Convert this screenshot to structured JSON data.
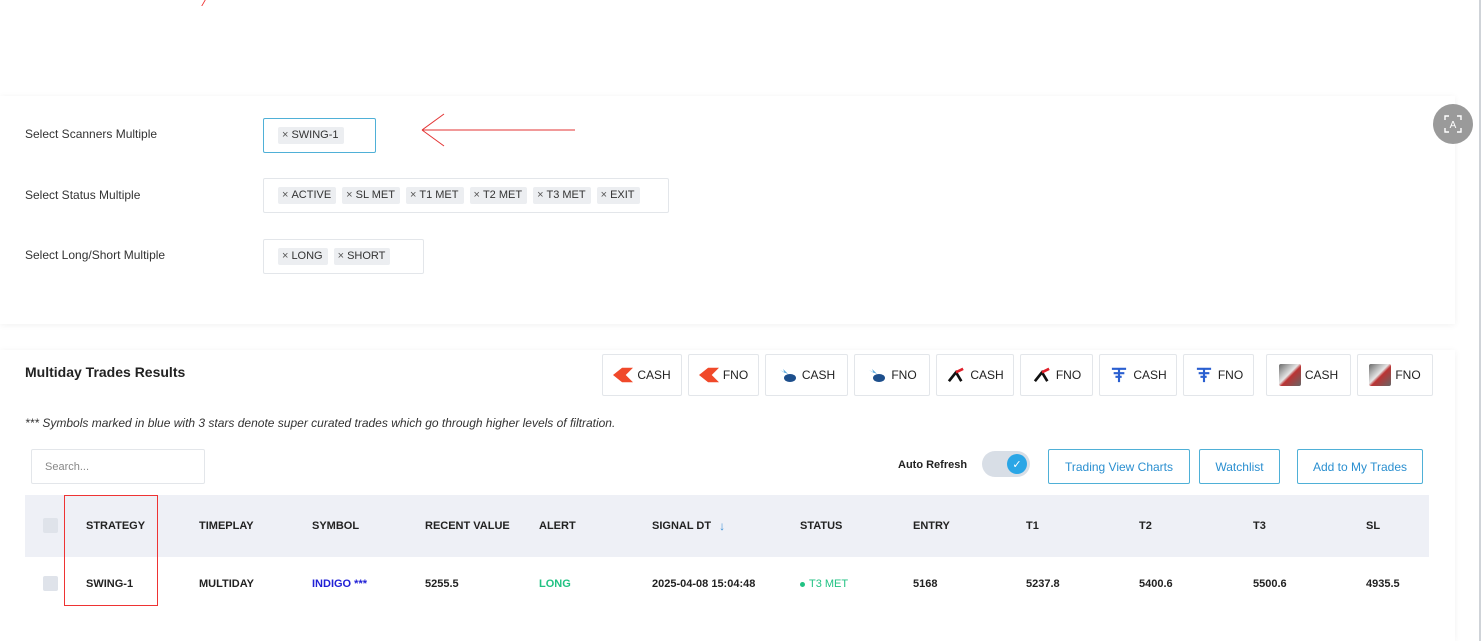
{
  "filters": {
    "scanners": {
      "label": "Select Scanners Multiple",
      "chips": [
        "SWING-1"
      ]
    },
    "status": {
      "label": "Select Status Multiple",
      "chips": [
        "ACTIVE",
        "SL MET",
        "T1 MET",
        "T2 MET",
        "T3 MET",
        "EXIT"
      ]
    },
    "long_short": {
      "label": "Select Long/Short Multiple",
      "chips": [
        "LONG",
        "SHORT"
      ]
    },
    "chip_remove_glyph": "×"
  },
  "results": {
    "title": "Multiday Trades Results",
    "brokers": [
      {
        "logo": "kite-icon",
        "label": "CASH"
      },
      {
        "logo": "kite-icon",
        "label": "FNO"
      },
      {
        "logo": "bird-icon",
        "label": "CASH"
      },
      {
        "logo": "bird-icon",
        "label": "FNO"
      },
      {
        "logo": "x-logo-icon",
        "label": "CASH"
      },
      {
        "logo": "x-logo-icon",
        "label": "FNO"
      },
      {
        "logo": "f-logo-icon",
        "label": "CASH"
      },
      {
        "logo": "f-logo-icon",
        "label": "FNO"
      },
      {
        "logo": "image-logo-icon",
        "label": "CASH"
      },
      {
        "logo": "image-logo-icon",
        "label": "FNO"
      }
    ],
    "disclaimer": "*** Symbols marked in blue with 3 stars denote super curated trades which go through higher levels of filtration.",
    "search_placeholder": "Search...",
    "auto_refresh_label": "Auto Refresh",
    "buttons": {
      "trading_view": "Trading View Charts",
      "watchlist": "Watchlist",
      "add_to_my_trades": "Add to My Trades"
    },
    "table": {
      "headers": {
        "strategy": "STRATEGY",
        "timeplay": "TIMEPLAY",
        "symbol": "SYMBOL",
        "recent_value": "RECENT VALUE",
        "alert": "ALERT",
        "signal_dt": "SIGNAL DT",
        "status": "STATUS",
        "entry": "ENTRY",
        "t1": "T1",
        "t2": "T2",
        "t3": "T3",
        "sl": "SL"
      },
      "sort_glyph": "↓",
      "rows": [
        {
          "strategy": "SWING-1",
          "timeplay": "MULTIDAY",
          "symbol": "INDIGO ***",
          "recent_value": "5255.5",
          "alert": "LONG",
          "signal_dt": "2025-04-08 15:04:48",
          "status": "T3 MET",
          "entry": "5168",
          "t1": "5237.8",
          "t2": "5400.6",
          "t3": "5500.6",
          "sl": "4935.5"
        }
      ]
    }
  },
  "colors": {
    "accent_blue": "#2a8fd0",
    "toggle_blue": "#2aa6e6",
    "long_green": "#21c283",
    "symbol_blue": "#2121d6",
    "annotation_red": "#e33333"
  }
}
